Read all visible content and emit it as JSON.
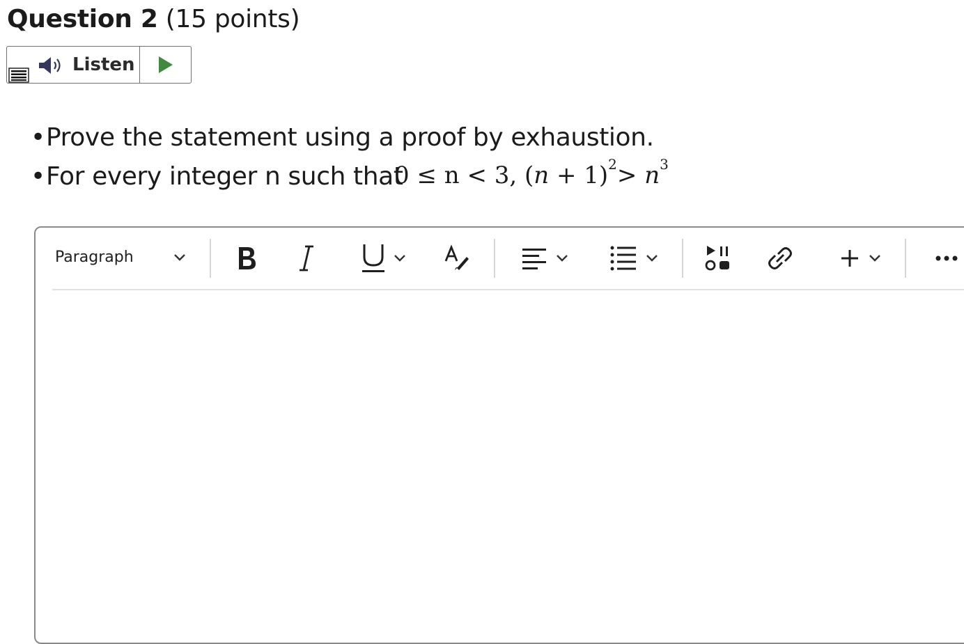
{
  "question": {
    "title": "Question 2",
    "points": "(15 points)"
  },
  "listen": {
    "label": "Listen"
  },
  "prompt": {
    "line1": "Prove the statement using a proof by exhaustion.",
    "line2": "For every integer n such that",
    "math": {
      "part1": "0 ≤ n < 3, (",
      "var1": "n",
      "part2": " + 1)",
      "exp1": "2",
      "part3": "> ",
      "var2": "n",
      "exp2": "3"
    }
  },
  "editor": {
    "format_select": "Paragraph",
    "tools": [
      "bold-icon",
      "italic-icon",
      "underline-icon",
      "format-painter-icon",
      "align-left-icon",
      "list-icon",
      "media-icon",
      "link-icon",
      "plus-icon",
      "more-icon"
    ]
  },
  "colors": {
    "play": "#3f8a3f",
    "speaker": "#35385c",
    "border": "#8a8a8a"
  }
}
